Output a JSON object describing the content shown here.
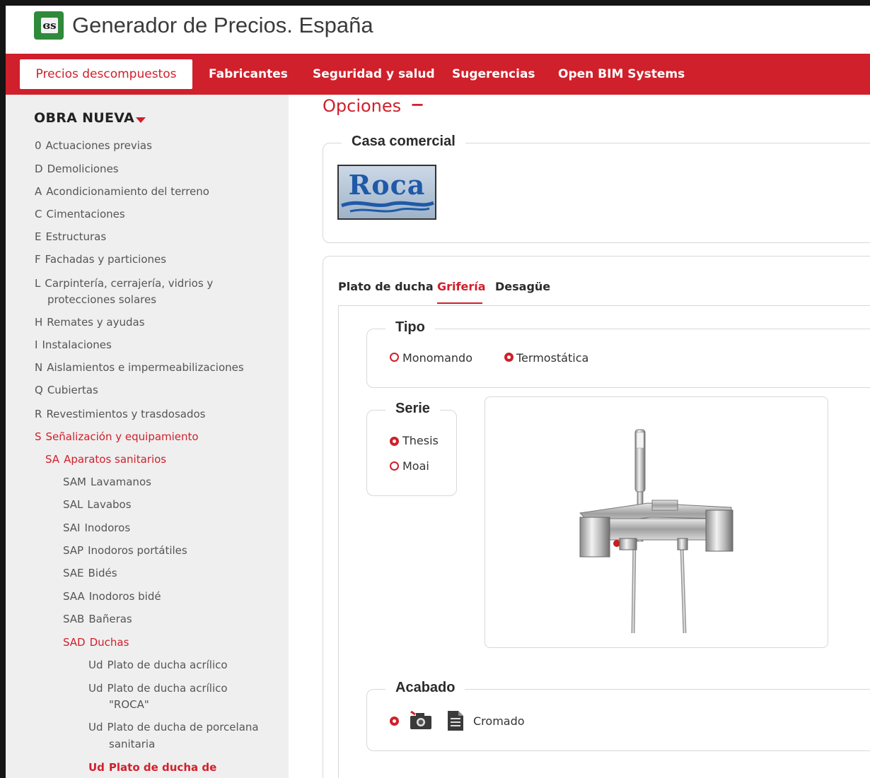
{
  "header": {
    "title": "Generador de Precios. España",
    "logo_text": "ɞs"
  },
  "nav": {
    "items": [
      {
        "label": "Precios descompuestos",
        "active": true
      },
      {
        "label": "Fabricantes"
      },
      {
        "label": "Seguridad y salud"
      },
      {
        "label": "Sugerencias"
      },
      {
        "label": "Open BIM Systems"
      }
    ]
  },
  "sidebar": {
    "title": "OBRA NUEVA",
    "items": [
      {
        "code": "0",
        "label": "Actuaciones previas"
      },
      {
        "code": "D",
        "label": "Demoliciones"
      },
      {
        "code": "A",
        "label": "Acondicionamiento del terreno"
      },
      {
        "code": "C",
        "label": "Cimentaciones"
      },
      {
        "code": "E",
        "label": "Estructuras"
      },
      {
        "code": "F",
        "label": "Fachadas y particiones"
      },
      {
        "code": "L",
        "label": "Carpintería, cerrajería, vidrios y",
        "label2": "protecciones solares"
      },
      {
        "code": "H",
        "label": "Remates y ayudas"
      },
      {
        "code": "I",
        "label": "Instalaciones"
      },
      {
        "code": "N",
        "label": "Aislamientos e impermeabilizaciones"
      },
      {
        "code": "Q",
        "label": "Cubiertas"
      },
      {
        "code": "R",
        "label": "Revestimientos y trasdosados"
      },
      {
        "code": "S",
        "label": "Señalización y equipamiento"
      },
      {
        "code": "SA",
        "label": "Aparatos sanitarios"
      },
      {
        "code": "SAM",
        "label": "Lavamanos"
      },
      {
        "code": "SAL",
        "label": "Lavabos"
      },
      {
        "code": "SAI",
        "label": "Inodoros"
      },
      {
        "code": "SAP",
        "label": "Inodoros portátiles"
      },
      {
        "code": "SAE",
        "label": "Bidés"
      },
      {
        "code": "SAA",
        "label": "Inodoros bidé"
      },
      {
        "code": "SAB",
        "label": "Bañeras"
      },
      {
        "code": "SAD",
        "label": "Duchas"
      },
      {
        "code": "Ud",
        "label": "Plato de ducha acrílico"
      },
      {
        "code": "Ud",
        "label": "Plato de ducha acrílico",
        "label2": "\"ROCA\""
      },
      {
        "code": "Ud",
        "label": "Plato de ducha de porcelana",
        "label2": "sanitaria"
      },
      {
        "code": "Ud",
        "label": "Plato de ducha de"
      }
    ]
  },
  "main": {
    "options_title": "Opciones",
    "options_toggle": "−",
    "brand_legend": "Casa comercial",
    "brand_logo": "Roca",
    "tabs": [
      "Plato de ducha",
      "Grifería",
      "Desagüe"
    ],
    "tipo": {
      "legend": "Tipo",
      "options": [
        "Monomando",
        "Termostática"
      ],
      "selected": "Termostática"
    },
    "serie": {
      "legend": "Serie",
      "options": [
        "Thesis",
        "Moai"
      ],
      "selected": "Thesis"
    },
    "acabado": {
      "legend": "Acabado",
      "options": [
        "Cromado"
      ],
      "selected": "Cromado"
    }
  },
  "colors": {
    "accent": "#d0202b",
    "logo_green": "#2f8a3c",
    "sidebar_bg": "#efefef"
  }
}
